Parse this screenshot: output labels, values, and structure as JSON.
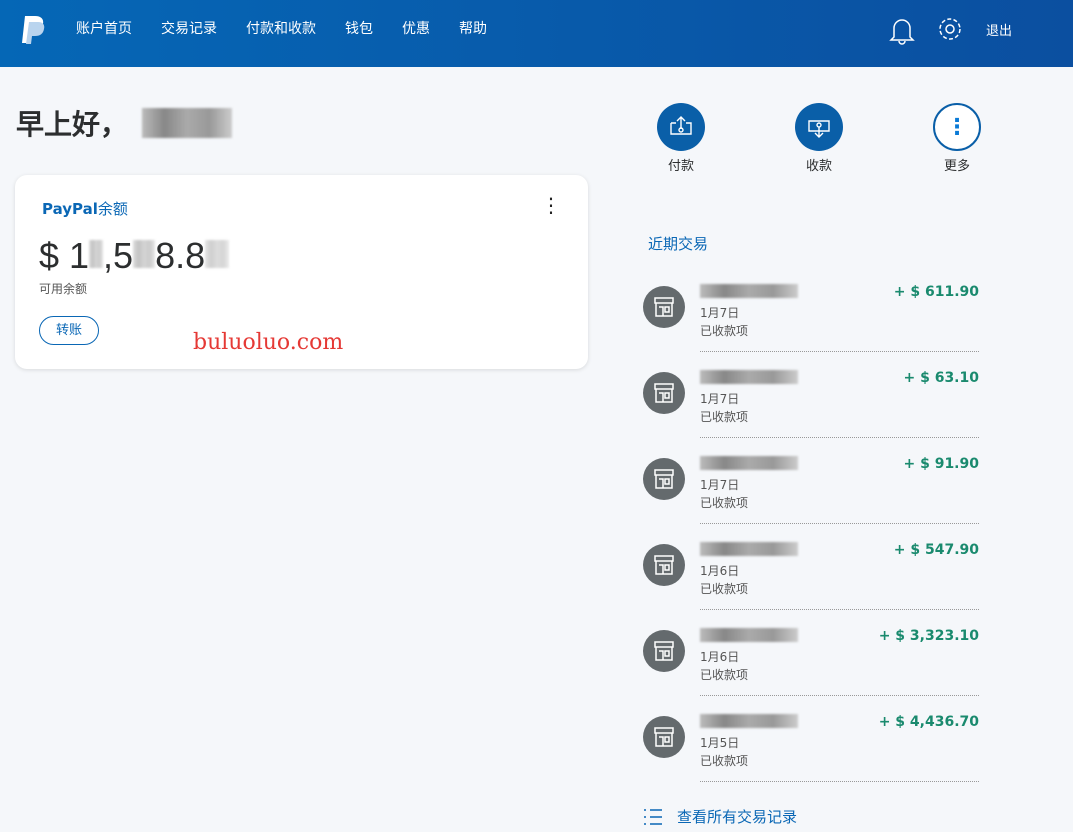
{
  "header": {
    "nav": [
      "账户首页",
      "交易记录",
      "付款和收款",
      "钱包",
      "优惠",
      "帮助"
    ],
    "logout": "退出"
  },
  "greeting": "早上好，",
  "balance_card": {
    "title_brand": "PayPal",
    "title_suffix": "余额",
    "balance": "$ 1",
    "balance_tail": ",5",
    "balance_tail2": "8.8",
    "available": "可用余额",
    "transfer": "转账"
  },
  "watermark": "buluoluo.com",
  "actions": [
    {
      "label": "付款"
    },
    {
      "label": "收款"
    },
    {
      "label": "更多"
    }
  ],
  "recent_title": "近期交易",
  "transactions": [
    {
      "date": "1月7日",
      "status": "已收款项",
      "amount": "+ $ 611.90"
    },
    {
      "date": "1月7日",
      "status": "已收款项",
      "amount": "+ $ 63.10"
    },
    {
      "date": "1月7日",
      "status": "已收款项",
      "amount": "+ $ 91.90"
    },
    {
      "date": "1月6日",
      "status": "已收款项",
      "amount": "+ $ 547.90"
    },
    {
      "date": "1月6日",
      "status": "已收款项",
      "amount": "+ $ 3,323.10"
    },
    {
      "date": "1月5日",
      "status": "已收款项",
      "amount": "+ $ 4,436.70"
    }
  ],
  "view_all": "查看所有交易记录",
  "colors": {
    "brand": "#0a5fa8",
    "positive": "#1a8a6e"
  }
}
